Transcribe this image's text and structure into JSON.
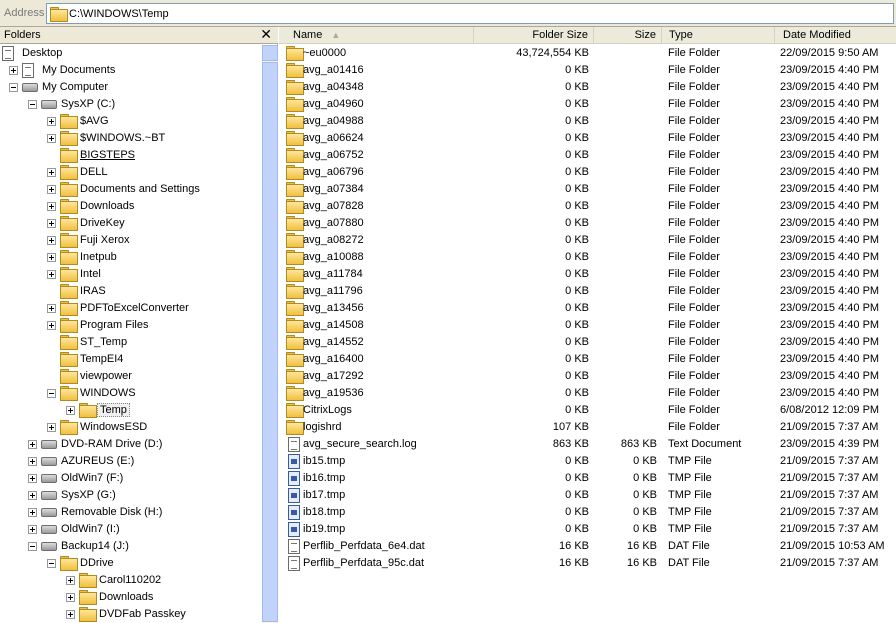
{
  "address": {
    "label": "Address",
    "value": "C:\\WINDOWS\\Temp"
  },
  "folders_pane": {
    "title": "Folders",
    "close": "✕"
  },
  "tree": [
    {
      "label": "Desktop",
      "level": 0,
      "icon": "desktop-icon",
      "expander": "none"
    },
    {
      "label": "My Documents",
      "level": 1,
      "icon": "my-documents-icon",
      "expander": "plus"
    },
    {
      "label": "My Computer",
      "level": 1,
      "icon": "my-computer-icon",
      "expander": "minus"
    },
    {
      "label": "SysXP (C:)",
      "level": 2,
      "icon": "drive-icon",
      "expander": "minus"
    },
    {
      "label": "$AVG",
      "level": 3,
      "icon": "folder-icon",
      "expander": "plus"
    },
    {
      "label": "$WINDOWS.~BT",
      "level": 3,
      "icon": "folder-icon",
      "expander": "plus"
    },
    {
      "label": "BIGSTEPS",
      "level": 3,
      "icon": "folder-icon",
      "expander": "none",
      "link": true
    },
    {
      "label": "DELL",
      "level": 3,
      "icon": "folder-icon",
      "expander": "plus"
    },
    {
      "label": "Documents and Settings",
      "level": 3,
      "icon": "folder-icon",
      "expander": "plus"
    },
    {
      "label": "Downloads",
      "level": 3,
      "icon": "folder-icon",
      "expander": "plus"
    },
    {
      "label": "DriveKey",
      "level": 3,
      "icon": "folder-icon",
      "expander": "plus"
    },
    {
      "label": "Fuji Xerox",
      "level": 3,
      "icon": "folder-icon",
      "expander": "plus"
    },
    {
      "label": "Inetpub",
      "level": 3,
      "icon": "folder-icon",
      "expander": "plus"
    },
    {
      "label": "Intel",
      "level": 3,
      "icon": "folder-icon",
      "expander": "plus"
    },
    {
      "label": "IRAS",
      "level": 3,
      "icon": "folder-icon",
      "expander": "none"
    },
    {
      "label": "PDFToExcelConverter",
      "level": 3,
      "icon": "folder-icon",
      "expander": "plus"
    },
    {
      "label": "Program Files",
      "level": 3,
      "icon": "folder-icon",
      "expander": "plus"
    },
    {
      "label": "ST_Temp",
      "level": 3,
      "icon": "folder-icon",
      "expander": "none"
    },
    {
      "label": "TempEI4",
      "level": 3,
      "icon": "folder-icon",
      "expander": "none"
    },
    {
      "label": "viewpower",
      "level": 3,
      "icon": "folder-icon",
      "expander": "none"
    },
    {
      "label": "WINDOWS",
      "level": 3,
      "icon": "folder-icon",
      "expander": "minus"
    },
    {
      "label": "Temp",
      "level": 4,
      "icon": "folder-icon",
      "expander": "plus",
      "selected": true
    },
    {
      "label": "WindowsESD",
      "level": 3,
      "icon": "folder-icon",
      "expander": "plus"
    },
    {
      "label": "DVD-RAM Drive (D:)",
      "level": 2,
      "icon": "dvd-drive-icon",
      "expander": "plus"
    },
    {
      "label": "AZUREUS (E:)",
      "level": 2,
      "icon": "drive-icon",
      "expander": "plus"
    },
    {
      "label": "OldWin7 (F:)",
      "level": 2,
      "icon": "drive-icon",
      "expander": "plus"
    },
    {
      "label": "SysXP (G:)",
      "level": 2,
      "icon": "drive-icon",
      "expander": "plus"
    },
    {
      "label": "Removable Disk (H:)",
      "level": 2,
      "icon": "drive-icon",
      "expander": "plus"
    },
    {
      "label": "OldWin7 (I:)",
      "level": 2,
      "icon": "drive-icon",
      "expander": "plus"
    },
    {
      "label": "Backup14 (J:)",
      "level": 2,
      "icon": "drive-icon",
      "expander": "minus"
    },
    {
      "label": "DDrive",
      "level": 3,
      "icon": "folder-icon",
      "expander": "minus"
    },
    {
      "label": "Carol110202",
      "level": 4,
      "icon": "user-folder-icon",
      "expander": "plus"
    },
    {
      "label": "Downloads",
      "level": 4,
      "icon": "folder-icon",
      "expander": "plus"
    },
    {
      "label": "DVDFab Passkey",
      "level": 4,
      "icon": "folder-icon",
      "expander": "plus"
    }
  ],
  "columns": {
    "name": "Name",
    "folder_size": "Folder Size",
    "size": "Size",
    "type": "Type",
    "date": "Date Modified"
  },
  "files": [
    {
      "name": "~eu0000",
      "folder_size": "43,724,554 KB",
      "size": "",
      "type": "File Folder",
      "date": "22/09/2015 9:50 AM",
      "icon": "folder"
    },
    {
      "name": "avg_a01416",
      "folder_size": "0 KB",
      "size": "",
      "type": "File Folder",
      "date": "23/09/2015 4:40 PM",
      "icon": "folder"
    },
    {
      "name": "avg_a04348",
      "folder_size": "0 KB",
      "size": "",
      "type": "File Folder",
      "date": "23/09/2015 4:40 PM",
      "icon": "folder"
    },
    {
      "name": "avg_a04960",
      "folder_size": "0 KB",
      "size": "",
      "type": "File Folder",
      "date": "23/09/2015 4:40 PM",
      "icon": "folder"
    },
    {
      "name": "avg_a04988",
      "folder_size": "0 KB",
      "size": "",
      "type": "File Folder",
      "date": "23/09/2015 4:40 PM",
      "icon": "folder"
    },
    {
      "name": "avg_a06624",
      "folder_size": "0 KB",
      "size": "",
      "type": "File Folder",
      "date": "23/09/2015 4:40 PM",
      "icon": "folder"
    },
    {
      "name": "avg_a06752",
      "folder_size": "0 KB",
      "size": "",
      "type": "File Folder",
      "date": "23/09/2015 4:40 PM",
      "icon": "folder"
    },
    {
      "name": "avg_a06796",
      "folder_size": "0 KB",
      "size": "",
      "type": "File Folder",
      "date": "23/09/2015 4:40 PM",
      "icon": "folder"
    },
    {
      "name": "avg_a07384",
      "folder_size": "0 KB",
      "size": "",
      "type": "File Folder",
      "date": "23/09/2015 4:40 PM",
      "icon": "folder"
    },
    {
      "name": "avg_a07828",
      "folder_size": "0 KB",
      "size": "",
      "type": "File Folder",
      "date": "23/09/2015 4:40 PM",
      "icon": "folder"
    },
    {
      "name": "avg_a07880",
      "folder_size": "0 KB",
      "size": "",
      "type": "File Folder",
      "date": "23/09/2015 4:40 PM",
      "icon": "folder"
    },
    {
      "name": "avg_a08272",
      "folder_size": "0 KB",
      "size": "",
      "type": "File Folder",
      "date": "23/09/2015 4:40 PM",
      "icon": "folder"
    },
    {
      "name": "avg_a10088",
      "folder_size": "0 KB",
      "size": "",
      "type": "File Folder",
      "date": "23/09/2015 4:40 PM",
      "icon": "folder"
    },
    {
      "name": "avg_a11784",
      "folder_size": "0 KB",
      "size": "",
      "type": "File Folder",
      "date": "23/09/2015 4:40 PM",
      "icon": "folder"
    },
    {
      "name": "avg_a11796",
      "folder_size": "0 KB",
      "size": "",
      "type": "File Folder",
      "date": "23/09/2015 4:40 PM",
      "icon": "folder"
    },
    {
      "name": "avg_a13456",
      "folder_size": "0 KB",
      "size": "",
      "type": "File Folder",
      "date": "23/09/2015 4:40 PM",
      "icon": "folder"
    },
    {
      "name": "avg_a14508",
      "folder_size": "0 KB",
      "size": "",
      "type": "File Folder",
      "date": "23/09/2015 4:40 PM",
      "icon": "folder"
    },
    {
      "name": "avg_a14552",
      "folder_size": "0 KB",
      "size": "",
      "type": "File Folder",
      "date": "23/09/2015 4:40 PM",
      "icon": "folder"
    },
    {
      "name": "avg_a16400",
      "folder_size": "0 KB",
      "size": "",
      "type": "File Folder",
      "date": "23/09/2015 4:40 PM",
      "icon": "folder"
    },
    {
      "name": "avg_a17292",
      "folder_size": "0 KB",
      "size": "",
      "type": "File Folder",
      "date": "23/09/2015 4:40 PM",
      "icon": "folder"
    },
    {
      "name": "avg_a19536",
      "folder_size": "0 KB",
      "size": "",
      "type": "File Folder",
      "date": "23/09/2015 4:40 PM",
      "icon": "folder"
    },
    {
      "name": "CitrixLogs",
      "folder_size": "0 KB",
      "size": "",
      "type": "File Folder",
      "date": "6/08/2012 12:09 PM",
      "icon": "folder"
    },
    {
      "name": "logishrd",
      "folder_size": "107 KB",
      "size": "",
      "type": "File Folder",
      "date": "21/09/2015 7:37 AM",
      "icon": "folder"
    },
    {
      "name": "avg_secure_search.log",
      "folder_size": "863 KB",
      "size": "863 KB",
      "type": "Text Document",
      "date": "23/09/2015 4:39 PM",
      "icon": "doc"
    },
    {
      "name": "ib15.tmp",
      "folder_size": "0 KB",
      "size": "0 KB",
      "type": "TMP File",
      "date": "21/09/2015 7:37 AM",
      "icon": "tmp"
    },
    {
      "name": "ib16.tmp",
      "folder_size": "0 KB",
      "size": "0 KB",
      "type": "TMP File",
      "date": "21/09/2015 7:37 AM",
      "icon": "tmp"
    },
    {
      "name": "ib17.tmp",
      "folder_size": "0 KB",
      "size": "0 KB",
      "type": "TMP File",
      "date": "21/09/2015 7:37 AM",
      "icon": "tmp"
    },
    {
      "name": "ib18.tmp",
      "folder_size": "0 KB",
      "size": "0 KB",
      "type": "TMP File",
      "date": "21/09/2015 7:37 AM",
      "icon": "tmp"
    },
    {
      "name": "ib19.tmp",
      "folder_size": "0 KB",
      "size": "0 KB",
      "type": "TMP File",
      "date": "21/09/2015 7:37 AM",
      "icon": "tmp"
    },
    {
      "name": "Perflib_Perfdata_6e4.dat",
      "folder_size": "16 KB",
      "size": "16 KB",
      "type": "DAT File",
      "date": "21/09/2015 10:53 AM",
      "icon": "doc"
    },
    {
      "name": "Perflib_Perfdata_95c.dat",
      "folder_size": "16 KB",
      "size": "16 KB",
      "type": "DAT File",
      "date": "21/09/2015 7:37 AM",
      "icon": "doc"
    }
  ]
}
